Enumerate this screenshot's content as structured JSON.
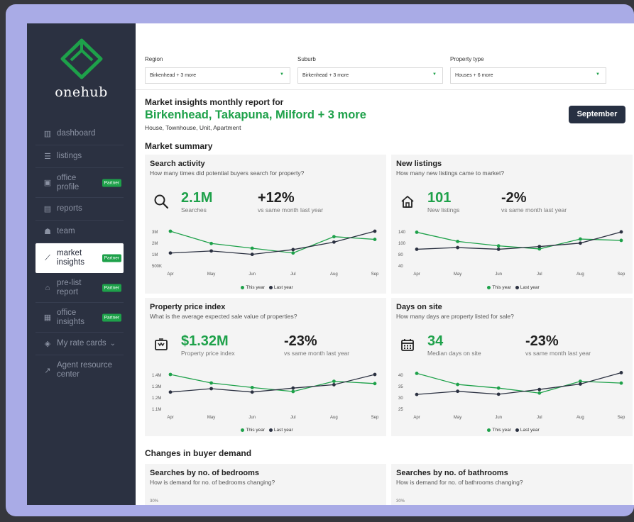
{
  "brand": {
    "name": "onehub"
  },
  "colors": {
    "accent": "#1ea14a",
    "sidebar": "#2b3141",
    "this_year": "#1ea14a",
    "last_year": "#2b3141"
  },
  "sidebar": {
    "items": [
      {
        "label": "dashboard",
        "icon": "dashboard-icon"
      },
      {
        "label": "listings",
        "icon": "list-icon"
      },
      {
        "label": "office profile",
        "icon": "office-profile-icon",
        "badge": "Partner"
      },
      {
        "label": "reports",
        "icon": "reports-icon"
      },
      {
        "label": "team",
        "icon": "team-icon"
      },
      {
        "label": "market insights",
        "icon": "chart-icon",
        "badge": "Partner",
        "active": true
      },
      {
        "label": "pre-list report",
        "icon": "home-icon",
        "badge": "Partner"
      },
      {
        "label": "office insights",
        "icon": "building-icon",
        "badge": "Partner"
      },
      {
        "label": "My rate cards",
        "icon": "tag-icon",
        "chevron": "⌄"
      },
      {
        "label": "Agent resource center",
        "icon": "external-link-icon"
      }
    ]
  },
  "filters": [
    {
      "label": "Region",
      "value": "Birkenhead + 3 more"
    },
    {
      "label": "Suburb",
      "value": "Birkenhead + 3 more"
    },
    {
      "label": "Property type",
      "value": "Houses + 6 more"
    }
  ],
  "report": {
    "title": "Market insights monthly report for",
    "areas": "Birkenhead, Takapuna, Milford + 3 more",
    "types": "House, Townhouse, Unit, Apartment",
    "month": "September"
  },
  "sections": {
    "summary": "Market summary",
    "demand": "Changes in buyer demand"
  },
  "legend": {
    "this_year": "This year",
    "last_year": "Last year"
  },
  "cards": [
    {
      "title": "Search activity",
      "subtitle": "How many times did potential buyers search for property?",
      "icon": "search-icon",
      "value": "2.1M",
      "value_label": "Searches",
      "change": "+12%",
      "change_label": "vs same month last year"
    },
    {
      "title": "New listings",
      "subtitle": "How many new listings came to market?",
      "icon": "home-icon",
      "value": "101",
      "value_label": "New listings",
      "change": "-2%",
      "change_label": "vs same month last year"
    },
    {
      "title": "Property price index",
      "subtitle": "What is the average expected sale value of properties?",
      "icon": "price-tag-icon",
      "value": "$1.32M",
      "value_label": "Property price index",
      "change": "-23%",
      "change_label": "vs same month last year"
    },
    {
      "title": "Days on site",
      "subtitle": "How many days are property listed for sale?",
      "icon": "calendar-icon",
      "value": "34",
      "value_label": "Median days on site",
      "change": "-23%",
      "change_label": "vs same month last year"
    }
  ],
  "demand_cards": [
    {
      "title": "Searches by no. of bedrooms",
      "subtitle": "How is demand for no. of bedrooms changing?"
    },
    {
      "title": "Searches by no. of bathrooms",
      "subtitle": "How is demand for no. of bathrooms changing?"
    }
  ],
  "chart_data": [
    {
      "type": "line",
      "x": [
        "Apr",
        "May",
        "Jun",
        "Jul",
        "Aug",
        "Sep"
      ],
      "yticks": [
        "3M",
        "2M",
        "1M",
        "500K"
      ],
      "ylim": [
        500000,
        3000000
      ],
      "series": [
        {
          "name": "This year",
          "values": [
            3000000,
            2100000,
            1750000,
            1400000,
            2600000,
            2400000
          ]
        },
        {
          "name": "Last year",
          "values": [
            1400000,
            1550000,
            1300000,
            1650000,
            2200000,
            3000000
          ]
        }
      ]
    },
    {
      "type": "line",
      "x": [
        "Apr",
        "May",
        "Jun",
        "Jul",
        "Aug",
        "Sep"
      ],
      "yticks": [
        "140",
        "100",
        "80",
        "40"
      ],
      "ylim": [
        40,
        140
      ],
      "series": [
        {
          "name": "This year",
          "values": [
            137,
            110,
            97,
            88,
            117,
            113
          ]
        },
        {
          "name": "Last year",
          "values": [
            87,
            92,
            87,
            95,
            105,
            138
          ]
        }
      ]
    },
    {
      "type": "line",
      "x": [
        "Apr",
        "May",
        "Jun",
        "Jul",
        "Aug",
        "Sep"
      ],
      "yticks": [
        "1.4M",
        "1.3M",
        "1.2M",
        "1.1M"
      ],
      "ylim": [
        1100000,
        1400000
      ],
      "series": [
        {
          "name": "This year",
          "values": [
            1400000,
            1325000,
            1285000,
            1250000,
            1340000,
            1320000
          ]
        },
        {
          "name": "Last year",
          "values": [
            1245000,
            1275000,
            1245000,
            1280000,
            1310000,
            1400000
          ]
        }
      ]
    },
    {
      "type": "line",
      "x": [
        "Apr",
        "May",
        "Jun",
        "Jul",
        "Aug",
        "Sep"
      ],
      "yticks": [
        "40",
        "35",
        "30",
        "25"
      ],
      "ylim": [
        25,
        40
      ],
      "series": [
        {
          "name": "This year",
          "values": [
            40.5,
            35.6,
            34.0,
            31.8,
            37.0,
            36.2
          ]
        },
        {
          "name": "Last year",
          "values": [
            31.2,
            32.6,
            31.3,
            33.4,
            35.8,
            40.8
          ]
        }
      ]
    }
  ],
  "demand_chart_label": "30%"
}
